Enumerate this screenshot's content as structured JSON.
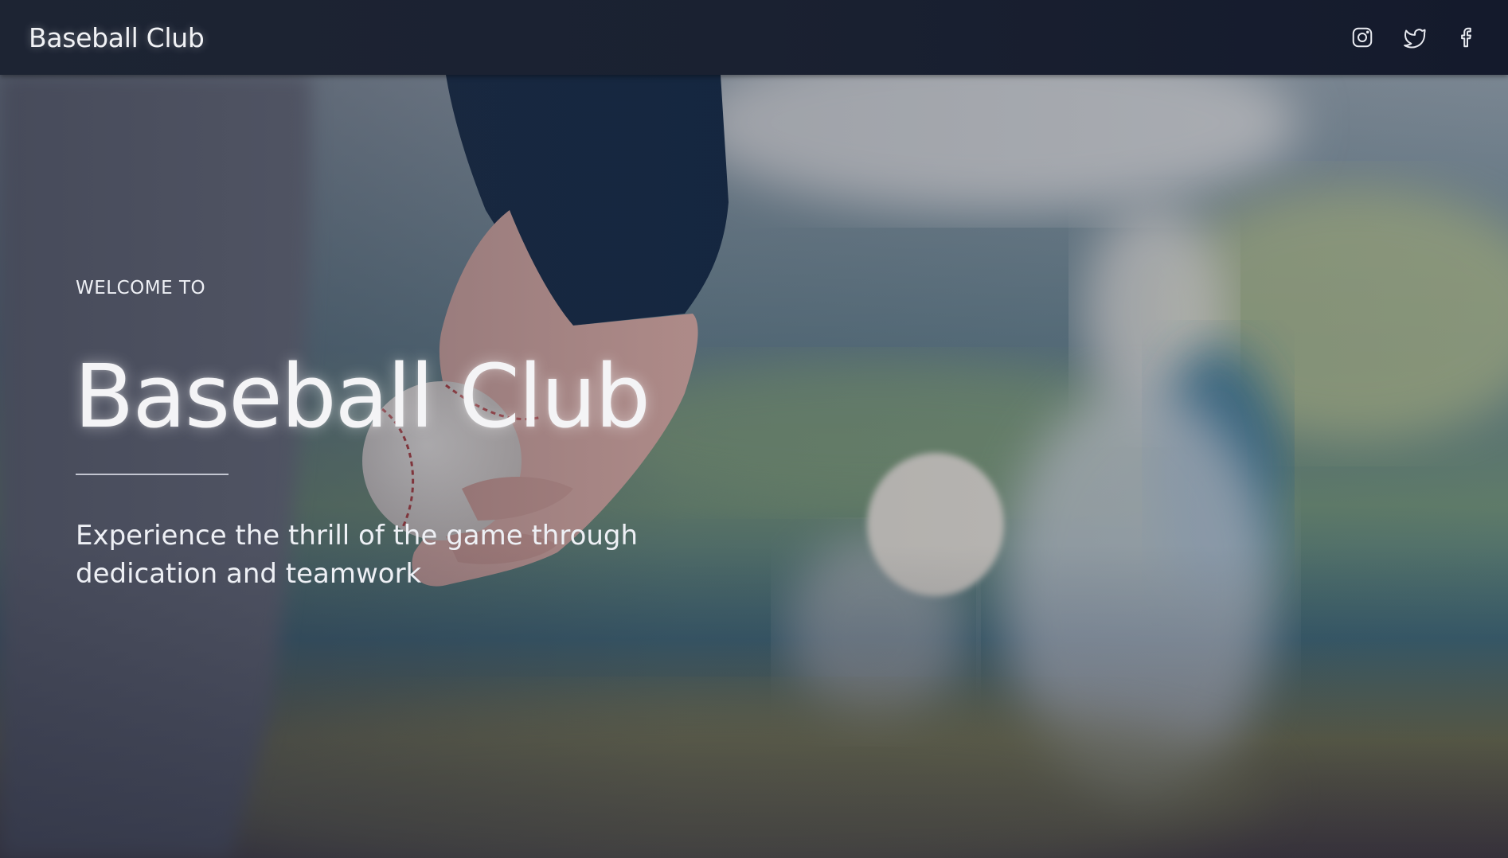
{
  "navbar": {
    "brand": "Baseball Club",
    "social": [
      {
        "icon": "instagram-icon"
      },
      {
        "icon": "twitter-icon"
      },
      {
        "icon": "facebook-icon"
      }
    ]
  },
  "hero": {
    "eyebrow": "WELCOME TO",
    "title": "Baseball Club",
    "tagline": "Experience the thrill of the game through dedication and teamwork"
  },
  "colors": {
    "navbar_bg": "#1a2131",
    "text": "#f1f2f5",
    "overlay": "#282c3e"
  }
}
